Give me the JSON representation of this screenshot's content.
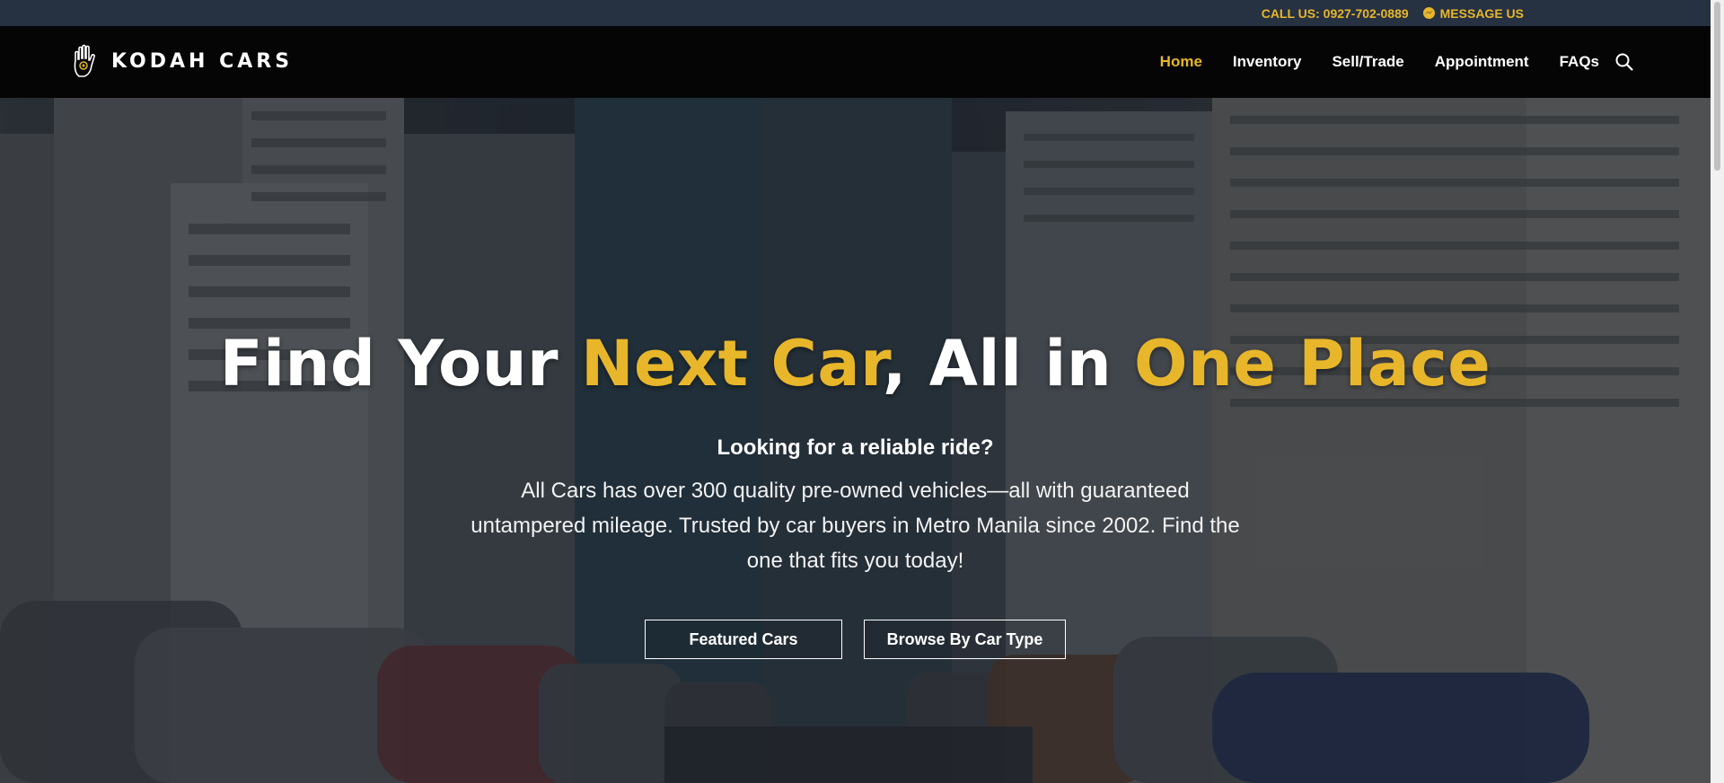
{
  "topbar": {
    "call_label": "CALL US: 0927-702-0889",
    "message_label": "MESSAGE US",
    "message_icon": "messenger-icon"
  },
  "brand": {
    "name": "KODAH CARS",
    "logo_icon": "hamsa-hand-logo"
  },
  "nav": {
    "items": [
      {
        "label": "Home",
        "active": true
      },
      {
        "label": "Inventory",
        "active": false
      },
      {
        "label": "Sell/Trade",
        "active": false
      },
      {
        "label": "Appointment",
        "active": false
      },
      {
        "label": "FAQs",
        "active": false
      }
    ],
    "search_icon": "search-icon"
  },
  "hero": {
    "headline_part1": "Find Your ",
    "headline_highlight1": "Next Car",
    "headline_part2": ", All in ",
    "headline_highlight2": "One Place",
    "subheading": "Looking for a reliable ride?",
    "description": "All Cars has over 300 quality pre-owned vehicles—all with guaranteed untampered mileage. Trusted by car buyers in Metro Manila since 2002. Find the one that fits you today!",
    "buttons": {
      "featured": "Featured Cars",
      "browse": "Browse By Car Type"
    }
  },
  "colors": {
    "accent": "#e8b62a",
    "topbar_bg": "#263142",
    "nav_bg": "#050505"
  }
}
